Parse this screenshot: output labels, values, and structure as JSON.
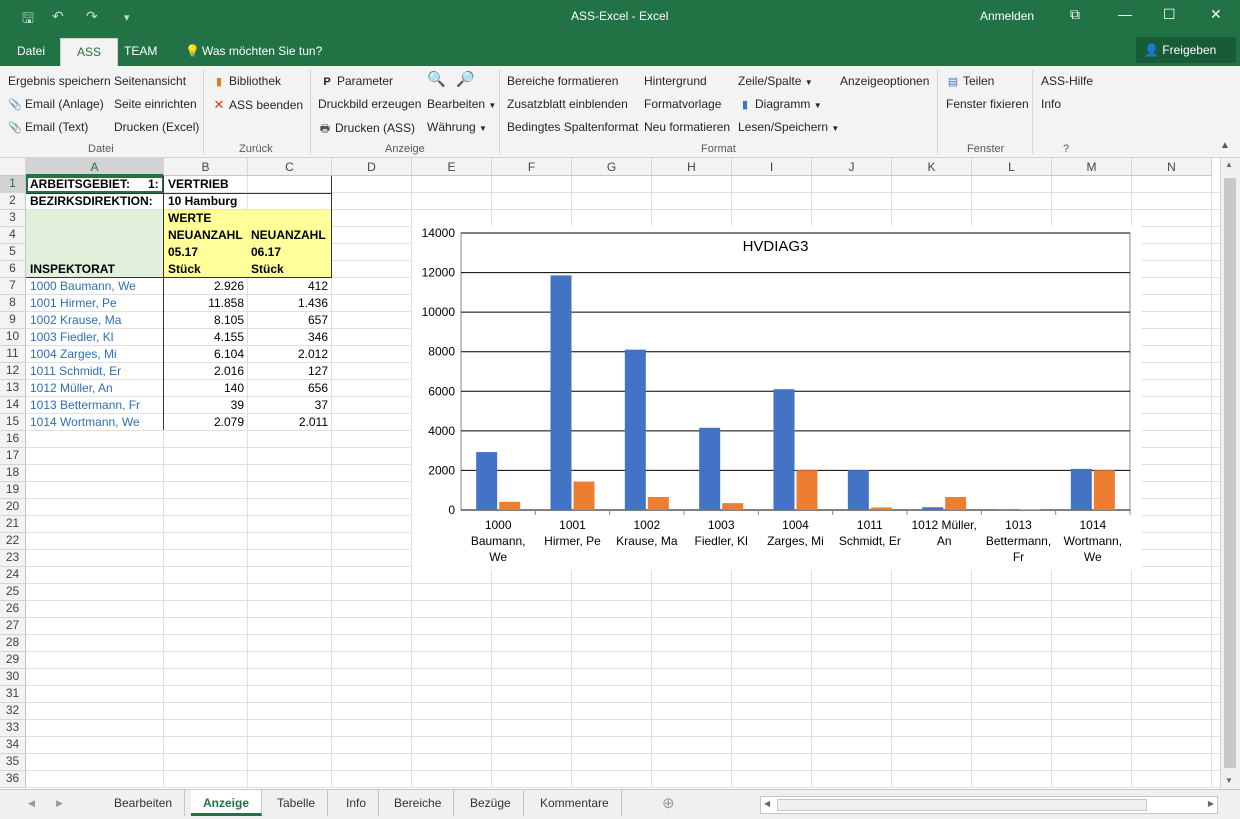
{
  "window": {
    "title": "ASS-Excel  -  Excel",
    "signin": "Anmelden",
    "qat_save": "🖫",
    "qat_undo": "↶",
    "qat_redo": "↷",
    "qat_customize": "▾",
    "min": "—",
    "max": "☐",
    "close": "✕",
    "ribbon_display": "⧉"
  },
  "tabs": {
    "datei": "Datei",
    "ass": "ASS",
    "team": "TEAM",
    "tellme": "Was möchten Sie tun?",
    "share": "Freigeben"
  },
  "ribbon": {
    "datei": {
      "label": "Datei",
      "ergebnis": "Ergebnis speichern",
      "email_anlage": "Email (Anlage)",
      "email_text": "Email (Text)",
      "seitenansicht": "Seitenansicht",
      "seite_einrichten": "Seite einrichten",
      "drucken_excel": "Drucken (Excel)"
    },
    "zurueck": {
      "label": "Zurück",
      "bibliothek": "Bibliothek",
      "ass_beenden": "ASS beenden"
    },
    "anzeige": {
      "label": "Anzeige",
      "parameter": "Parameter",
      "druckbild": "Druckbild erzeugen",
      "drucken_ass": "Drucken (ASS)",
      "bearbeiten": "Bearbeiten",
      "waehrung": "Währung"
    },
    "format": {
      "label": "Format",
      "bereiche": "Bereiche formatieren",
      "zusatzblatt": "Zusatzblatt einblenden",
      "bedingtes": "Bedingtes Spaltenformat",
      "hintergrund": "Hintergrund",
      "formatvorlage": "Formatvorlage",
      "neu_formatieren": "Neu formatieren",
      "zeile_spalte": "Zeile/Spalte",
      "diagramm": "Diagramm",
      "lesen_speichern": "Lesen/Speichern",
      "anzeigeoptionen": "Anzeigeoptionen"
    },
    "fenster": {
      "label": "Fenster",
      "teilen": "Teilen",
      "fixieren": "Fenster fixieren"
    },
    "hilfe": {
      "label": "?",
      "ass_hilfe": "ASS-Hilfe",
      "info": "Info"
    }
  },
  "columns": [
    "A",
    "B",
    "C",
    "D",
    "E",
    "F",
    "G",
    "H",
    "I",
    "J",
    "K",
    "L",
    "M",
    "N"
  ],
  "rows": [
    "1",
    "2",
    "3",
    "4",
    "5",
    "6",
    "7",
    "8",
    "9",
    "10",
    "11",
    "12",
    "13",
    "14",
    "15",
    "16",
    "17",
    "18",
    "19",
    "20",
    "21",
    "22",
    "23",
    "24",
    "25",
    "26",
    "27",
    "28",
    "29",
    "30",
    "31",
    "32",
    "33",
    "34",
    "35",
    "36"
  ],
  "sheet": {
    "a1": "ARBEITSGEBIET:",
    "a1_code": "1:",
    "b1": "VERTRIEB",
    "a2": "BEZIRKSDIREKTION:",
    "b2": "10 Hamburg",
    "b3": "WERTE",
    "b4": "NEUANZAHL",
    "c4": "NEUANZAHL",
    "b5": "05.17",
    "c5": "06.17",
    "b6": "Stück",
    "c6": "Stück",
    "a6": "INSPEKTORAT",
    "data_rows": [
      {
        "name": "1000 Baumann, We",
        "b": "2.926",
        "c": "412"
      },
      {
        "name": "1001 Hirmer, Pe",
        "b": "11.858",
        "c": "1.436"
      },
      {
        "name": "1002 Krause, Ma",
        "b": "8.105",
        "c": "657"
      },
      {
        "name": "1003 Fiedler, Kl",
        "b": "4.155",
        "c": "346"
      },
      {
        "name": "1004 Zarges, Mi",
        "b": "6.104",
        "c": "2.012"
      },
      {
        "name": "1011 Schmidt, Er",
        "b": "2.016",
        "c": "127"
      },
      {
        "name": "1012 Müller, An",
        "b": "140",
        "c": "656"
      },
      {
        "name": "1013 Bettermann, Fr",
        "b": "39",
        "c": "37"
      },
      {
        "name": "1014 Wortmann, We",
        "b": "2.079",
        "c": "2.011"
      }
    ]
  },
  "chart_data": {
    "type": "bar",
    "title": "HVDIAG3",
    "categories": [
      [
        "1000",
        "Baumann,",
        "We"
      ],
      [
        "1001",
        "Hirmer, Pe"
      ],
      [
        "1002",
        "Krause, Ma"
      ],
      [
        "1003",
        "Fiedler, Kl"
      ],
      [
        "1004",
        "Zarges, Mi"
      ],
      [
        "1011",
        "Schmidt, Er"
      ],
      [
        "1012 Müller,",
        "An"
      ],
      [
        "1013",
        "Bettermann,",
        "Fr"
      ],
      [
        "1014",
        "Wortmann,",
        "We"
      ]
    ],
    "series": [
      {
        "values": [
          2926,
          11858,
          8105,
          4155,
          6104,
          2016,
          140,
          39,
          2079
        ],
        "color": "#4472c4"
      },
      {
        "values": [
          412,
          1436,
          657,
          346,
          2012,
          127,
          656,
          37,
          2011
        ],
        "color": "#ed7d31"
      }
    ],
    "ylim": [
      0,
      14000
    ],
    "yticks": [
      0,
      2000,
      4000,
      6000,
      8000,
      10000,
      12000,
      14000
    ],
    "grid": true
  },
  "sheettabs": [
    "Bearbeiten",
    "Anzeige",
    "Tabelle",
    "Info",
    "Bereiche",
    "Bezüge",
    "Kommentare"
  ],
  "active_sheet": "Anzeige",
  "nav": {
    "prev": "◀",
    "next": "▶",
    "add": "⊕",
    "scroll_left": "◀",
    "scroll_right": "▶",
    "scroll_up": "▲",
    "scroll_down": "▼"
  }
}
